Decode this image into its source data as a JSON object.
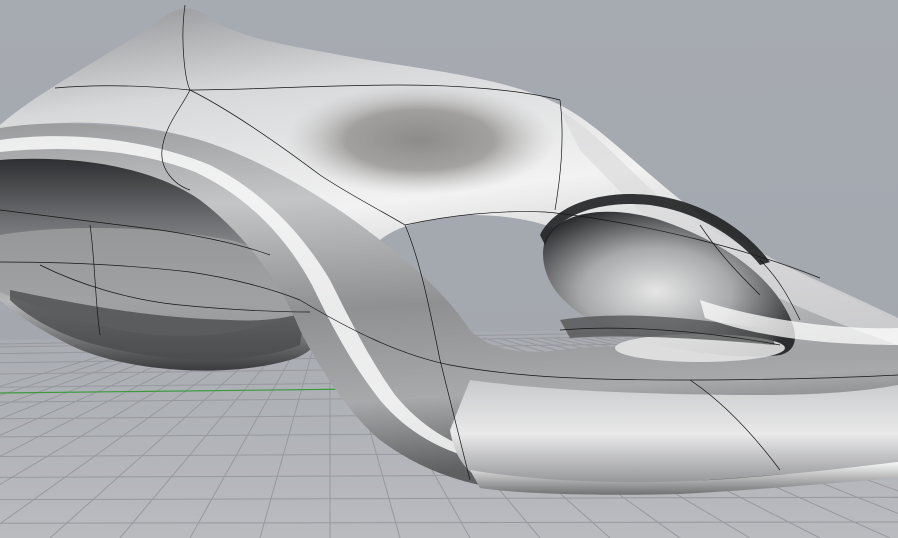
{
  "viewport": {
    "background_color": "#a5a9b0",
    "grid_color": "#97999e",
    "axis_x_color": "#3c9a3c"
  },
  "model": {
    "surface_type": "freeform-nurbs-surface",
    "shading": "metallic",
    "isocurve_color": "#151515"
  }
}
